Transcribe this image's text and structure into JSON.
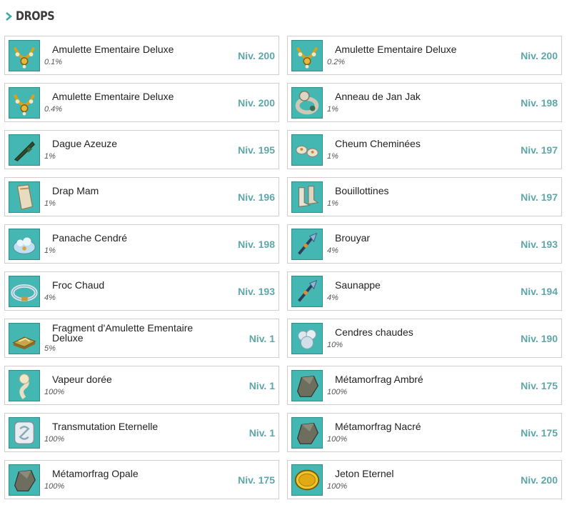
{
  "section": {
    "title": "DROPS",
    "icon": "chevron-right-icon"
  },
  "colors": {
    "accent": "#3aa9a7",
    "level": "#5fa6a8",
    "thumb_bg": "#44b7b2",
    "border": "#cfcfcf"
  },
  "drops": [
    {
      "name": "Amulette Ementaire Deluxe",
      "rate": "0.1%",
      "level": "Niv. 200",
      "icon": "amulet-icon"
    },
    {
      "name": "Amulette Ementaire Deluxe",
      "rate": "0.2%",
      "level": "Niv. 200",
      "icon": "amulet-icon"
    },
    {
      "name": "Amulette Ementaire Deluxe",
      "rate": "0.4%",
      "level": "Niv. 200",
      "icon": "amulet-icon"
    },
    {
      "name": "Anneau de Jan Jak",
      "rate": "1%",
      "level": "Niv. 198",
      "icon": "ring-icon"
    },
    {
      "name": "Dague Azeuze",
      "rate": "1%",
      "level": "Niv. 195",
      "icon": "dagger-icon"
    },
    {
      "name": "Cheum Cheminées",
      "rate": "1%",
      "level": "Niv. 197",
      "icon": "chimneys-icon"
    },
    {
      "name": "Drap Mam",
      "rate": "1%",
      "level": "Niv. 196",
      "icon": "cape-icon"
    },
    {
      "name": "Bouillottines",
      "rate": "1%",
      "level": "Niv. 197",
      "icon": "boots-icon"
    },
    {
      "name": "Panache Cendré",
      "rate": "1%",
      "level": "Niv. 198",
      "icon": "hat-icon"
    },
    {
      "name": "Brouyar",
      "rate": "4%",
      "level": "Niv. 193",
      "icon": "pet-icon"
    },
    {
      "name": "Froc Chaud",
      "rate": "4%",
      "level": "Niv. 193",
      "icon": "belt-icon"
    },
    {
      "name": "Saunappe",
      "rate": "4%",
      "level": "Niv. 194",
      "icon": "pet-icon"
    },
    {
      "name": "Fragment d'Amulette Ementaire Deluxe",
      "rate": "5%",
      "level": "Niv. 1",
      "icon": "fragment-icon"
    },
    {
      "name": "Cendres chaudes",
      "rate": "10%",
      "level": "Niv. 190",
      "icon": "ash-icon"
    },
    {
      "name": "Vapeur dorée",
      "rate": "100%",
      "level": "Niv. 1",
      "icon": "vapor-icon"
    },
    {
      "name": "Métamorfrag Ambré",
      "rate": "100%",
      "level": "Niv. 175",
      "icon": "stone-icon"
    },
    {
      "name": "Transmutation Eternelle",
      "rate": "100%",
      "level": "Niv. 1",
      "icon": "scroll-icon"
    },
    {
      "name": "Métamorfrag Nacré",
      "rate": "100%",
      "level": "Niv. 175",
      "icon": "stone-icon"
    },
    {
      "name": "Métamorfrag Opale",
      "rate": "100%",
      "level": "Niv. 175",
      "icon": "stone-icon"
    },
    {
      "name": "Jeton Eternel",
      "rate": "100%",
      "level": "Niv. 200",
      "icon": "coin-icon"
    }
  ]
}
